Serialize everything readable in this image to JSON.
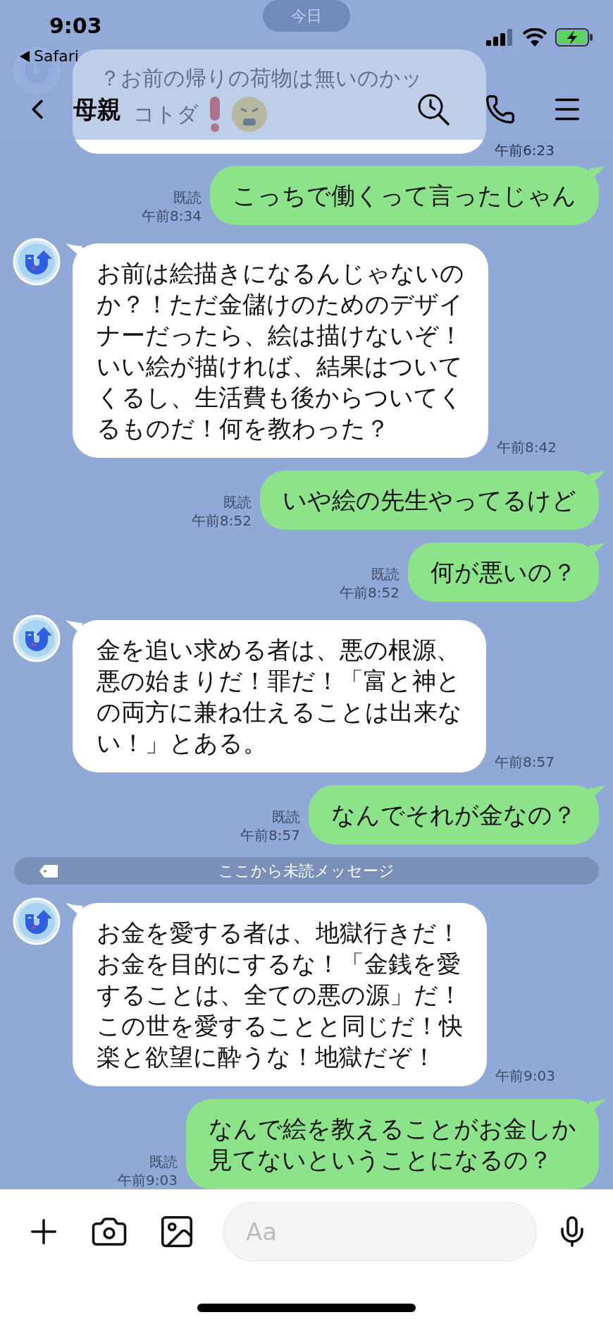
{
  "status_bar": {
    "time": "9:03",
    "back_app": "Safari"
  },
  "header": {
    "title": "母親"
  },
  "background_message": {
    "date": "今日",
    "lines": [
      "？お前の帰りの荷物は無いのかッ",
      "コトダ"
    ],
    "time": "午前6:23"
  },
  "messages": [
    {
      "kind": "sent",
      "lines": [
        "こっちで働くって言ったじゃん"
      ],
      "read": "既読",
      "time": "午前8:34"
    },
    {
      "kind": "received",
      "lines": [
        "お前は絵描きになるんじゃないの",
        "か？！ただ金儲けのためのデザイ",
        "ナーだったら、絵は描けないぞ！",
        "いい絵が描ければ、結果はついて",
        "くるし、生活費も後からついてく",
        "るものだ！何を教わった？"
      ],
      "time": "午前8:42"
    },
    {
      "kind": "sent",
      "lines": [
        "いや絵の先生やってるけど"
      ],
      "read": "既読",
      "time": "午前8:52"
    },
    {
      "kind": "sent",
      "lines": [
        "何が悪いの？"
      ],
      "read": "既読",
      "time": "午前8:52"
    },
    {
      "kind": "received",
      "lines": [
        "金を追い求める者は、悪の根源、",
        "悪の始まりだ！罪だ！「富と神と",
        "の両方に兼ね仕えることは出来な",
        "い！」とある。"
      ],
      "time": "午前8:57"
    },
    {
      "kind": "sent",
      "lines": [
        "なんでそれが金なの？"
      ],
      "read": "既読",
      "time": "午前8:57"
    },
    {
      "kind": "divider",
      "text": "ここから未読メッセージ"
    },
    {
      "kind": "received",
      "lines": [
        "お金を愛する者は、地獄行きだ！",
        "お金を目的にするな！「金銭を愛",
        "することは、全ての悪の源」だ！",
        "この世を愛することと同じだ！快",
        "楽と欲望に酔うな！地獄だぞ！"
      ],
      "time": "午前9:03"
    },
    {
      "kind": "sent",
      "lines": [
        "なんで絵を教えることがお金しか",
        "見てないということになるの？"
      ],
      "read": "既読",
      "time": "午前9:03"
    }
  ],
  "composer": {
    "placeholder": "Aa"
  }
}
